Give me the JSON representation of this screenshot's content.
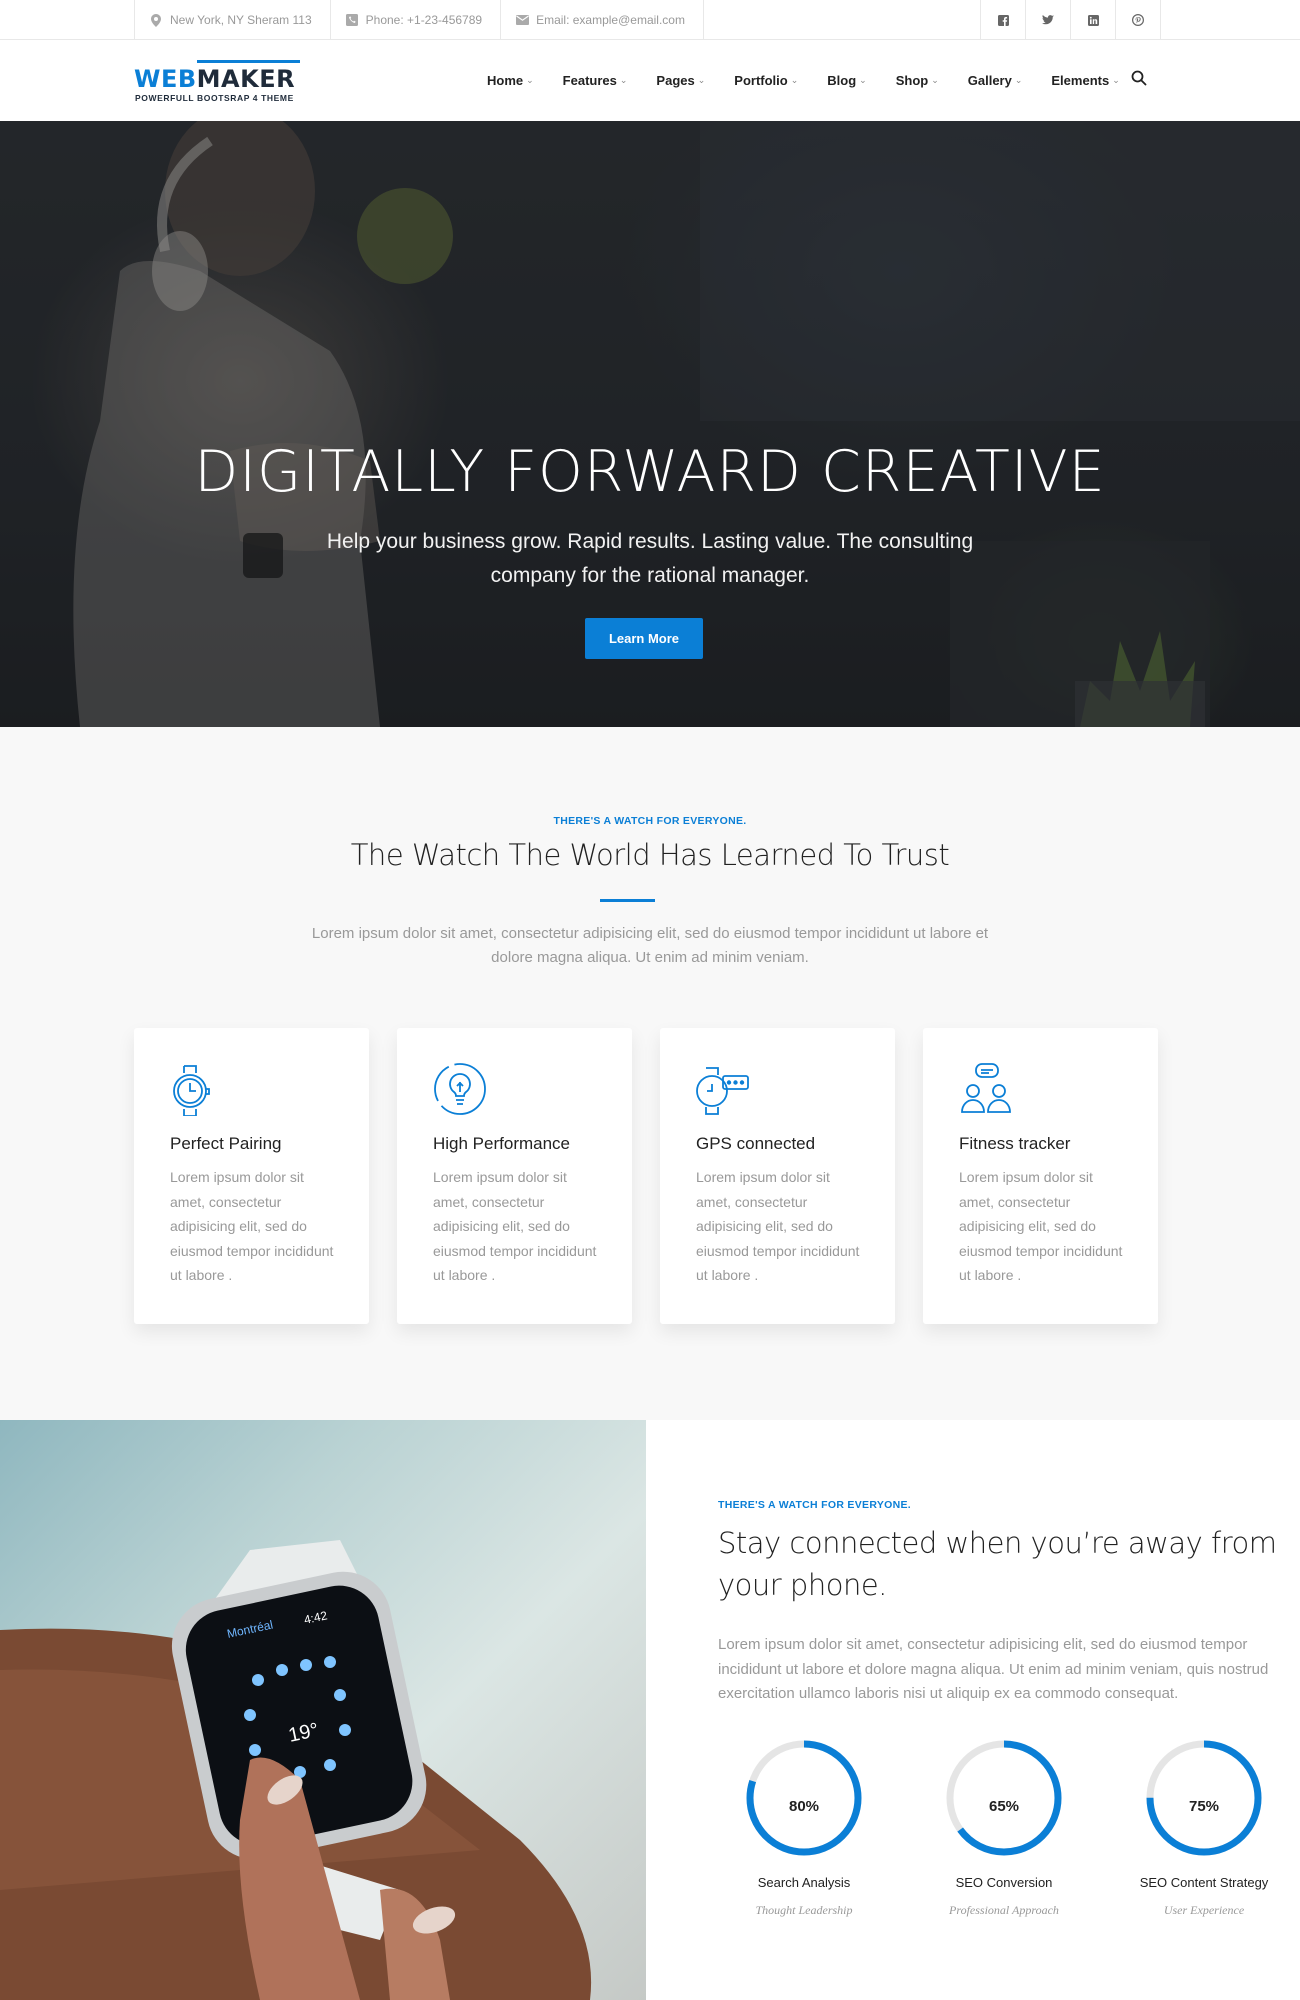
{
  "topbar": {
    "address": "New York, NY Sheram 113",
    "phone": "Phone: +1-23-456789",
    "email": "Email: example@email.com",
    "socials": [
      "facebook-icon",
      "twitter-icon",
      "linkedin-icon",
      "pinterest-icon"
    ]
  },
  "brand": {
    "name_part1": "WEB",
    "name_part2": "MAKER",
    "tagline": "POWERFULL BOOTSRAP 4 THEME",
    "accent_color": "#0b7fd6"
  },
  "nav": {
    "items": [
      "Home",
      "Features",
      "Pages",
      "Portfolio",
      "Blog",
      "Shop",
      "Gallery",
      "Elements"
    ]
  },
  "hero": {
    "title": "DIGITALLY FORWARD CREATIVE",
    "subtitle": "Help your business grow. Rapid results. Lasting value. The consulting company for the rational manager.",
    "button": "Learn More"
  },
  "features": {
    "eyebrow": "THERE'S A WATCH FOR EVERYONE.",
    "title": "The Watch The World Has Learned To Trust",
    "intro": "Lorem ipsum dolor sit amet, consectetur adipisicing elit, sed do eiusmod tempor incididunt ut labore et dolore magna aliqua. Ut enim ad minim veniam.",
    "cards": [
      {
        "icon": "watch-icon",
        "title": "Perfect Pairing",
        "text": "Lorem ipsum dolor sit amet, consectetur adipisicing elit, sed do eiusmod tempor incididunt ut labore ."
      },
      {
        "icon": "lightbulb-icon",
        "title": "High Performance",
        "text": "Lorem ipsum dolor sit amet, consectetur adipisicing elit, sed do eiusmod tempor incididunt ut labore ."
      },
      {
        "icon": "smartwatch-message-icon",
        "title": "GPS connected",
        "text": "Lorem ipsum dolor sit amet, consectetur adipisicing elit, sed do eiusmod tempor incididunt ut labore ."
      },
      {
        "icon": "people-chat-icon",
        "title": "Fitness tracker",
        "text": "Lorem ipsum dolor sit amet, consectetur adipisicing elit, sed do eiusmod tempor incididunt ut labore ."
      }
    ]
  },
  "split": {
    "eyebrow": "THERE'S A WATCH FOR EVERYONE.",
    "title": "Stay connected when you’re away from your phone.",
    "paragraph": "Lorem ipsum dolor sit amet, consectetur adipisicing elit, sed do eiusmod tempor incididunt ut labore et dolore magna aliqua. Ut enim ad minim veniam, quis nostrud exercitation ullamco laboris nisi ut aliquip ex ea commodo consequat.",
    "watch_screen": {
      "city": "Montréal",
      "time": "4:42",
      "temp": "19°"
    },
    "stats": [
      {
        "percent": 80,
        "percent_label": "80%",
        "label": "Search Analysis",
        "sub": "Thought Leadership"
      },
      {
        "percent": 65,
        "percent_label": "65%",
        "label": "SEO Conversion",
        "sub": "Professional Approach"
      },
      {
        "percent": 75,
        "percent_label": "75%",
        "label": "SEO Content Strategy",
        "sub": "User Experience"
      }
    ]
  }
}
